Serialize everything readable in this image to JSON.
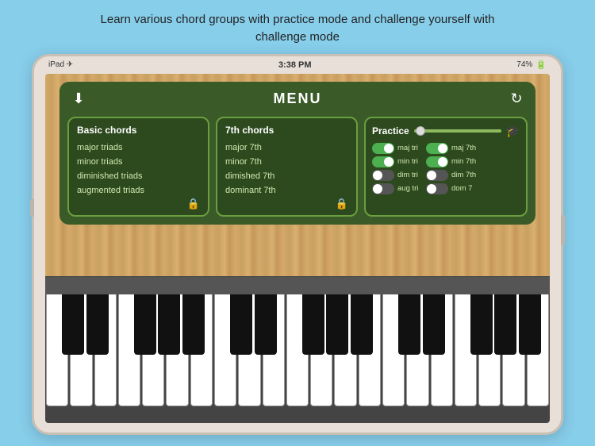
{
  "header": {
    "text_line1": "Learn various chord groups with practice mode and challenge yourself with",
    "text_line2": "challenge mode"
  },
  "statusbar": {
    "left": "iPad ✈",
    "center": "3:38 PM",
    "right": "74%"
  },
  "menu": {
    "title": "MENU",
    "download_icon": "⬇",
    "refresh_icon": "↻"
  },
  "basic_chords": {
    "title": "Basic chords",
    "items": [
      "major triads",
      "minor triads",
      "diminished triads",
      "augmented triads"
    ]
  },
  "seventh_chords": {
    "title": "7th chords",
    "items": [
      "major 7th",
      "minor 7th",
      "dimished 7th",
      "dominant 7th"
    ]
  },
  "practice": {
    "title": "Practice",
    "toggles": [
      {
        "label_left": "maj tri",
        "label_right": "maj 7th",
        "on": true
      },
      {
        "label_left": "min tri",
        "label_right": "min 7th",
        "on": true
      },
      {
        "label_left": "dim tri",
        "label_right": "dim 7th",
        "on": false
      },
      {
        "label_left": "aug tri",
        "label_right": "dom 7",
        "on": false
      }
    ]
  }
}
